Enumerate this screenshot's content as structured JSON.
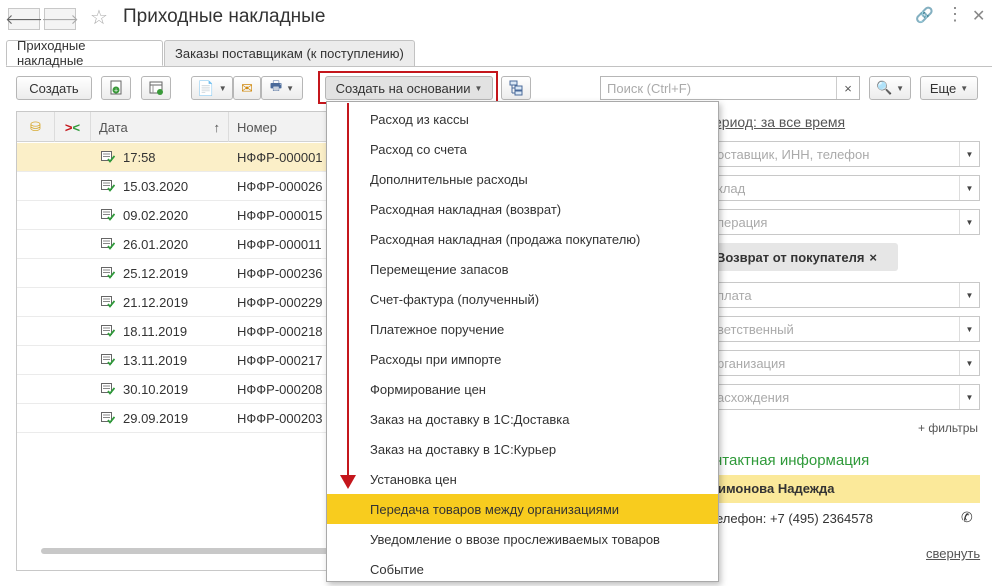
{
  "window": {
    "title": "Приходные накладные"
  },
  "tabs": [
    {
      "label": "Приходные накладные"
    },
    {
      "label": "Заказы поставщикам (к поступлению)"
    }
  ],
  "toolbar": {
    "create_label": "Создать",
    "create_based_label": "Создать на основании",
    "search_placeholder": "Поиск (Ctrl+F)",
    "search_clear": "×",
    "more_label": "Еще"
  },
  "table": {
    "columns": [
      "Дата",
      "Номер"
    ],
    "sort_indicator": "↑",
    "rows": [
      {
        "date": "17:58",
        "number": "НФФР-000001"
      },
      {
        "date": "15.03.2020",
        "number": "НФФР-000026"
      },
      {
        "date": "09.02.2020",
        "number": "НФФР-000015"
      },
      {
        "date": "26.01.2020",
        "number": "НФФР-000011"
      },
      {
        "date": "25.12.2019",
        "number": "НФФР-000236"
      },
      {
        "date": "21.12.2019",
        "number": "НФФР-000229"
      },
      {
        "date": "18.11.2019",
        "number": "НФФР-000218"
      },
      {
        "date": "13.11.2019",
        "number": "НФФР-000217"
      },
      {
        "date": "30.10.2019",
        "number": "НФФР-000208"
      },
      {
        "date": "29.09.2019",
        "number": "НФФР-000203"
      }
    ]
  },
  "menu": {
    "items": [
      "Расход из кассы",
      "Расход со счета",
      "Дополнительные расходы",
      "Расходная накладная (возврат)",
      "Расходная накладная (продажа покупателю)",
      "Перемещение запасов",
      "Счет-фактура (полученный)",
      "Платежное поручение",
      "Расходы при импорте",
      "Формирование цен",
      "Заказ на доставку в 1С:Доставка",
      "Заказ на доставку в 1С:Курьер",
      "Установка цен",
      "Передача товаров между организациями",
      "Уведомление о ввозе прослеживаемых товаров",
      "Событие"
    ],
    "highlighted_index": 13
  },
  "filters": {
    "period": "ериод: за все время",
    "fields": [
      "оставщик, ИНН, телефон",
      "клад",
      "перация",
      "плата",
      "ветственный",
      "рганизация",
      "асхождения"
    ],
    "chip_label": "Возврат от покупателя",
    "chip_close": "×",
    "more_filters": "+ фильтры"
  },
  "contact": {
    "heading": "нтактная информация",
    "name": "имонова Надежда",
    "phone": "елефон: +7 (495) 2364578",
    "collapse": "свернуть"
  },
  "colors": {
    "accent_red": "#c4161c",
    "menu_highlight": "#f8cc1e",
    "selected_row": "#fbefc8",
    "contact_green": "#2f9a3a",
    "contact_name_bg": "#fbe99a"
  }
}
